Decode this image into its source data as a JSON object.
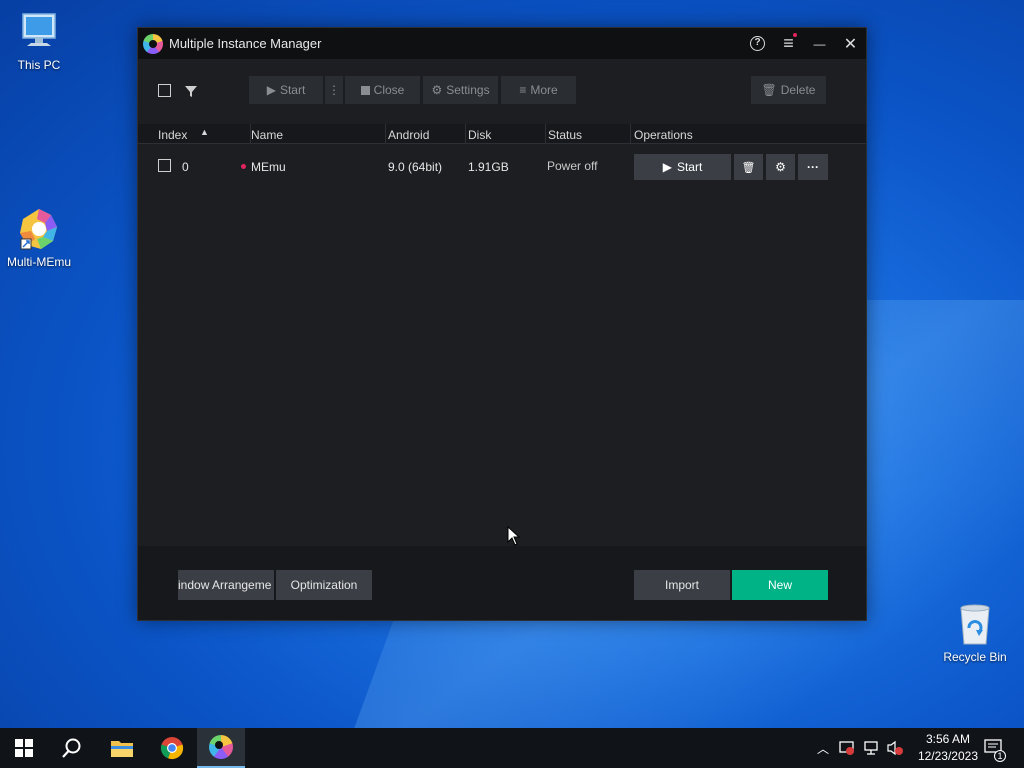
{
  "desktop": {
    "icons": [
      {
        "label": "This PC"
      },
      {
        "label": "Multi-MEmu"
      },
      {
        "label": "Recycle Bin"
      }
    ]
  },
  "window": {
    "title": "Multiple Instance Manager",
    "controls": {
      "help": "?",
      "menu": "≡",
      "minimize": "—",
      "close": "✕"
    }
  },
  "toolbar": {
    "start": "Start",
    "close": "Close",
    "settings": "Settings",
    "more": "More",
    "delete": "Delete"
  },
  "table": {
    "headers": [
      "Index",
      "Name",
      "Android",
      "Disk",
      "Status",
      "Operations"
    ],
    "rows": [
      {
        "index": "0",
        "name": "MEmu",
        "android": "9.0 (64bit)",
        "disk": "1.91GB",
        "status": "Power off",
        "start_label": "Start",
        "more_label": "···"
      }
    ]
  },
  "footer": {
    "window_arrangement": "indow Arrangeme",
    "optimization": "Optimization",
    "import": "Import",
    "new": "New"
  },
  "taskbar": {
    "clock_time": "3:56 AM",
    "clock_date": "12/23/2023",
    "notification_count": "1"
  },
  "colors": {
    "accent_new": "#00b386",
    "status_dot": "#e0245e",
    "window_bg": "#1c1e21",
    "titlebar_bg": "#0f1012"
  }
}
